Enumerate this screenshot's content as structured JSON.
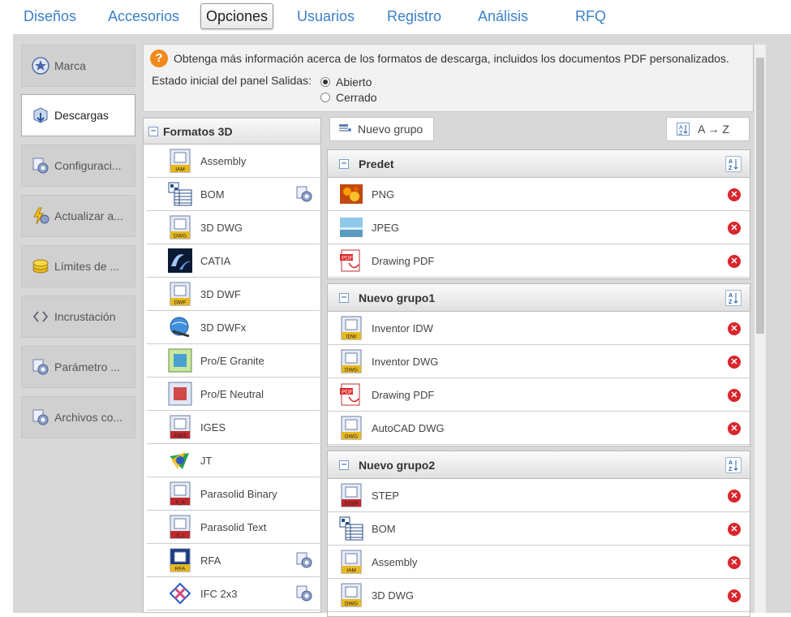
{
  "tabs": [
    {
      "label": "Diseños",
      "active": false
    },
    {
      "label": "Accesorios",
      "active": false
    },
    {
      "label": "Opciones",
      "active": true
    },
    {
      "label": "Usuarios",
      "active": false
    },
    {
      "label": "Registro",
      "active": false
    },
    {
      "label": "Análisis",
      "active": false
    },
    {
      "label": "RFQ",
      "active": false
    }
  ],
  "sidebar": [
    {
      "label": "Marca",
      "icon": "star-badge-icon",
      "active": false
    },
    {
      "label": "Descargas",
      "icon": "download-icon",
      "active": true
    },
    {
      "label": "Configuraci...",
      "icon": "config-gear-icon",
      "active": false
    },
    {
      "label": "Actualizar a...",
      "icon": "lightning-gear-icon",
      "active": false
    },
    {
      "label": "Límites de ...",
      "icon": "coins-icon",
      "active": false
    },
    {
      "label": "Incrustación",
      "icon": "code-brackets-icon",
      "active": false
    },
    {
      "label": "Parámetro ...",
      "icon": "parameter-gear-icon",
      "active": false
    },
    {
      "label": "Archivos co...",
      "icon": "files-gear-icon",
      "active": false
    }
  ],
  "info": {
    "text": "Obtenga más información acerca de los formatos de descarga, incluidos los documentos PDF personalizados.",
    "estado_label": "Estado inicial del panel Salidas:",
    "options": [
      {
        "label": "Abierto",
        "selected": true
      },
      {
        "label": "Cerrado",
        "selected": false
      }
    ]
  },
  "formats_panel": {
    "title": "Formatos 3D",
    "items": [
      {
        "label": "Assembly",
        "icon": "iam-file-icon",
        "config": false
      },
      {
        "label": "BOM",
        "icon": "bom-table-icon",
        "config": true
      },
      {
        "label": "3D DWG",
        "icon": "dwg-file-icon",
        "config": false
      },
      {
        "label": "CATIA",
        "icon": "catia-logo-icon",
        "config": false
      },
      {
        "label": "3D DWF",
        "icon": "dwf-file-icon",
        "config": false
      },
      {
        "label": "3D DWFx",
        "icon": "dwfx-globe-icon",
        "config": false
      },
      {
        "label": "Pro/E Granite",
        "icon": "proe-granite-icon",
        "config": false
      },
      {
        "label": "Pro/E Neutral",
        "icon": "proe-neutral-icon",
        "config": false
      },
      {
        "label": "IGES",
        "icon": "iges-file-icon",
        "config": false
      },
      {
        "label": "JT",
        "icon": "jt-logo-icon",
        "config": false
      },
      {
        "label": "Parasolid Binary",
        "icon": "parasolid-binary-icon",
        "config": false
      },
      {
        "label": "Parasolid Text",
        "icon": "parasolid-text-icon",
        "config": false
      },
      {
        "label": "RFA",
        "icon": "rfa-revit-icon",
        "config": true
      },
      {
        "label": "IFC 2x3",
        "icon": "ifc-logo-icon",
        "config": true
      }
    ]
  },
  "toolbar": {
    "new_group_label": "Nuevo grupo",
    "sort_label": "A → Z"
  },
  "groups": [
    {
      "title": "Predet",
      "items": [
        {
          "label": "PNG",
          "icon": "png-image-icon"
        },
        {
          "label": "JPEG",
          "icon": "jpeg-image-icon"
        },
        {
          "label": "Drawing PDF",
          "icon": "pdf-file-icon"
        }
      ]
    },
    {
      "title": "Nuevo grupo1",
      "items": [
        {
          "label": "Inventor IDW",
          "icon": "idw-file-icon"
        },
        {
          "label": "Inventor DWG",
          "icon": "dwg-file-icon"
        },
        {
          "label": "Drawing PDF",
          "icon": "pdf-file-icon"
        },
        {
          "label": "AutoCAD DWG",
          "icon": "dwg-file-icon"
        }
      ]
    },
    {
      "title": "Nuevo grupo2",
      "items": [
        {
          "label": "STEP",
          "icon": "step-file-icon"
        },
        {
          "label": "BOM",
          "icon": "bom-table-icon"
        },
        {
          "label": "Assembly",
          "icon": "iam-file-icon"
        },
        {
          "label": "3D DWG",
          "icon": "dwg-file-icon"
        }
      ]
    }
  ],
  "colors": {
    "accent": "#3a7fc8",
    "remove": "#d9262c",
    "help": "#f08a1c"
  }
}
